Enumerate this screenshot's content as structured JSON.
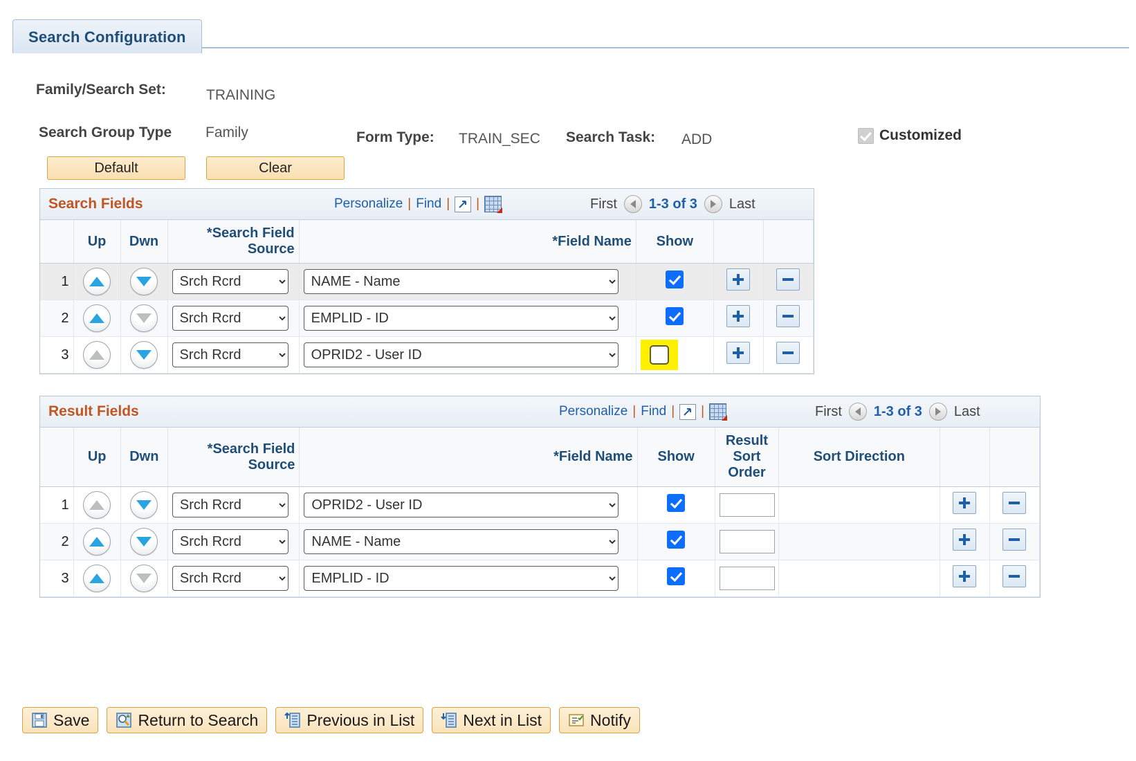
{
  "tab": {
    "label": "Search Configuration"
  },
  "header": {
    "family_set_label": "Family/Search Set:",
    "family_set_value": "TRAINING",
    "group_type_label": "Search Group Type",
    "group_type_value": "Family",
    "form_type_label": "Form Type:",
    "form_type_value": "TRAIN_SEC",
    "search_task_label": "Search Task:",
    "search_task_value": "ADD",
    "customized_label": "Customized",
    "customized_checked": true
  },
  "buttons": {
    "default_label": "Default",
    "clear_label": "Clear"
  },
  "grids": {
    "search_fields": {
      "title": "Search Fields",
      "tools": {
        "personalize": "Personalize",
        "find": "Find",
        "sep": "|",
        "expand_icon": "expand-icon",
        "download_icon": "grid-download-icon"
      },
      "pager": {
        "first": "First",
        "count": "1-3 of 3",
        "last": "Last"
      },
      "columns": {
        "up": "Up",
        "dwn": "Dwn",
        "source": "*Search Field Source",
        "field_name": "*Field Name",
        "show": "Show"
      },
      "rows": [
        {
          "num": "1",
          "up_enabled": true,
          "dwn_enabled": true,
          "source": "Srch Rcrd",
          "field_name": "NAME - Name",
          "show": true,
          "show_highlight": false
        },
        {
          "num": "2",
          "up_enabled": true,
          "dwn_enabled": false,
          "source": "Srch Rcrd",
          "field_name": "EMPLID - ID",
          "show": true,
          "show_highlight": false
        },
        {
          "num": "3",
          "up_enabled": false,
          "dwn_enabled": true,
          "source": "Srch Rcrd",
          "field_name": "OPRID2 - User ID",
          "show": false,
          "show_highlight": true
        }
      ],
      "source_options": [
        "Srch Rcrd"
      ],
      "field_options": [
        "NAME - Name",
        "EMPLID - ID",
        "OPRID2 - User ID"
      ]
    },
    "result_fields": {
      "title": "Result Fields",
      "tools": {
        "personalize": "Personalize",
        "find": "Find",
        "sep": "|",
        "expand_icon": "expand-icon",
        "download_icon": "grid-download-icon"
      },
      "pager": {
        "first": "First",
        "count": "1-3 of 3",
        "last": "Last"
      },
      "columns": {
        "up": "Up",
        "dwn": "Dwn",
        "source": "*Search Field Source",
        "field_name": "*Field Name",
        "show": "Show",
        "sort_order": "Result Sort Order",
        "sort_direction": "Sort Direction"
      },
      "rows": [
        {
          "num": "1",
          "up_enabled": false,
          "dwn_enabled": true,
          "source": "Srch Rcrd",
          "field_name": "OPRID2 - User ID",
          "show": true,
          "sort_order": "",
          "sort_direction": ""
        },
        {
          "num": "2",
          "up_enabled": true,
          "dwn_enabled": true,
          "source": "Srch Rcrd",
          "field_name": "NAME - Name",
          "show": true,
          "sort_order": "",
          "sort_direction": ""
        },
        {
          "num": "3",
          "up_enabled": true,
          "dwn_enabled": false,
          "source": "Srch Rcrd",
          "field_name": "EMPLID - ID",
          "show": true,
          "sort_order": "",
          "sort_direction": ""
        }
      ],
      "source_options": [
        "Srch Rcrd"
      ],
      "field_options": [
        "OPRID2 - User ID",
        "NAME - Name",
        "EMPLID - ID"
      ]
    }
  },
  "toolbar": [
    {
      "label": "Save",
      "icon": "save-floppy-icon"
    },
    {
      "label": "Return to Search",
      "icon": "return-to-search-icon"
    },
    {
      "label": "Previous in List",
      "icon": "previous-in-list-icon"
    },
    {
      "label": "Next in List",
      "icon": "next-in-list-icon"
    },
    {
      "label": "Notify",
      "icon": "notify-icon"
    }
  ],
  "colors": {
    "tab_text": "#1f4e79",
    "grid_title": "#c05621",
    "link": "#1f5fa8",
    "checkbox_checked": "#0d6efd",
    "highlight": "#ffef00",
    "button_face": "#f9dfb2"
  }
}
